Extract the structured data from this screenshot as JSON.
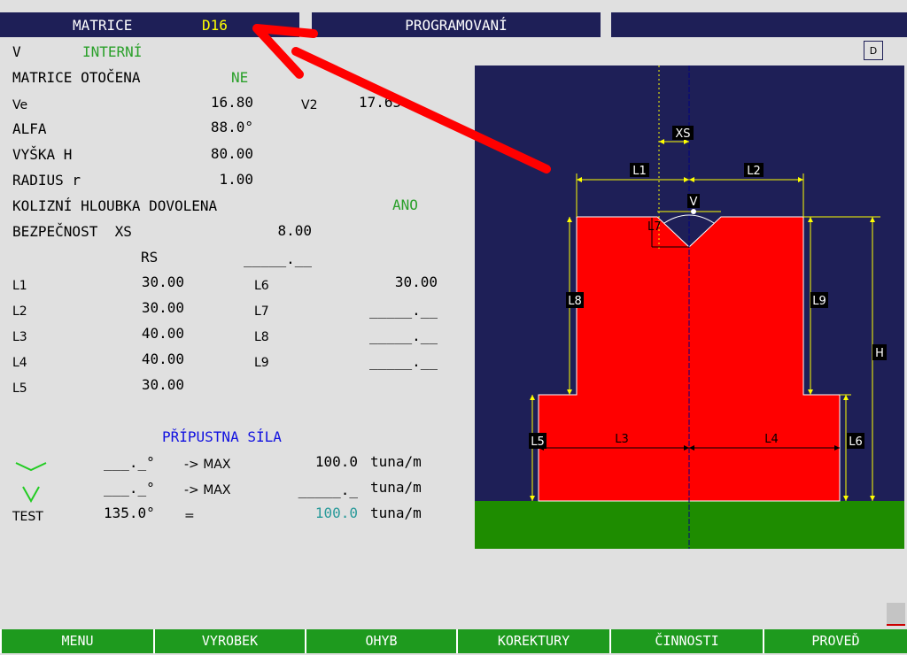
{
  "tabs": {
    "matrice_label": "MATRICE",
    "matrice_value": "D16",
    "programovani": "PROGRAMOVANÍ",
    "third": ""
  },
  "die": {
    "v_label": "V",
    "v_value": "INTERNÍ",
    "d_badge": "D",
    "rotated_label": "MATRICE OTOČENA",
    "rotated_value": "NE",
    "ve_label": "Ve",
    "ve_value": "16.80",
    "v2_label": "V2",
    "v2_value": "17.65",
    "alfa_label": "ALFA",
    "alfa_value": "88.0°",
    "vyska_label": "VYŠKA H",
    "vyska_value": "80.00",
    "radius_label": "RADIUS r",
    "radius_value": "1.00",
    "kolizni_label": "KOLIZNÍ HLOUBKA DOVOLENA",
    "kolizni_value": "ANO",
    "bezpecnost_label": "BEZPEČNOST  XS",
    "bezpecnost_value": "8.00",
    "rs_label": "RS",
    "rs_value": "_____.__"
  },
  "lengths_left": [
    {
      "label": "L1",
      "value": "30.00"
    },
    {
      "label": "L2",
      "value": "30.00"
    },
    {
      "label": "L3",
      "value": "40.00"
    },
    {
      "label": "L4",
      "value": "40.00"
    },
    {
      "label": "L5",
      "value": "30.00"
    }
  ],
  "lengths_right": [
    {
      "label": "L6",
      "value": "30.00"
    },
    {
      "label": "L7",
      "value": "_____.__"
    },
    {
      "label": "L8",
      "value": "_____.__"
    },
    {
      "label": "L9",
      "value": "_____.__"
    }
  ],
  "force": {
    "title": "PŘÍPUSTNA SÍLA",
    "rows": [
      {
        "angle": "___._°",
        "arrow": "-> MAX",
        "value": "100.0",
        "unit": "tuna/m"
      },
      {
        "angle": "___._°",
        "arrow": "-> MAX",
        "value": "_____._",
        "unit": "tuna/m"
      },
      {
        "prefix": "TEST",
        "angle": "135.0°",
        "arrow": "=",
        "value": "100.0",
        "unit": "tuna/m"
      }
    ]
  },
  "diagram_labels": {
    "xs": "XS",
    "l1": "L1",
    "l2": "L2",
    "v": "V",
    "l7": "L7",
    "l8": "L8",
    "l9": "L9",
    "h": "H",
    "l5": "L5",
    "l3": "L3",
    "l4": "L4",
    "l6": "L6"
  },
  "function_keys": [
    "MENU",
    "VYROBEK",
    "OHYB",
    "KOREKTURY",
    "ČINNOSTI",
    "PROVEĎ"
  ],
  "colors": {
    "panel_bg": "#1e1f57",
    "die_fill": "#ff0000",
    "base_fill": "#1e8c00",
    "dimension": "#ffff00",
    "accent_green": "#2aa02a",
    "fkey_bg": "#1e9a1e"
  }
}
